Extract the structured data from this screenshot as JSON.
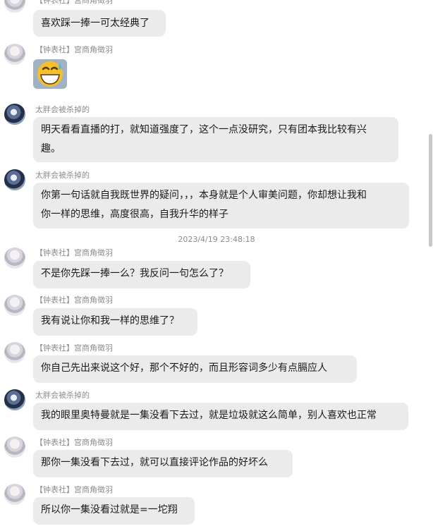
{
  "names": {
    "zhongbiao": "【钟表社】宫商角徵羽",
    "taipang": "太胖会被杀掉的"
  },
  "messages": [
    {
      "text": "喜欢踩一捧一可太经典了"
    },
    {
      "emoji": "grinning-sweat-emoji"
    },
    {
      "lines": [
        "明天看看直播的打，就知道强度了，这个一点没研究，只有团本我比较有兴",
        "趣。"
      ]
    },
    {
      "lines": [
        "你第一句话就自我既世界的疑问，，，本身就是个人审美问题，你却想让我和",
        "你一样的思维，高度很高，自我升华的样子"
      ]
    },
    {
      "text": "不是你先踩一捧一么？我反问一句怎么了？"
    },
    {
      "text": "我有说让你和我一样的思维了？"
    },
    {
      "text": "你自己先出来说这个好，那个不好的，而且形容词多少有点膈应人"
    },
    {
      "text": "我的眼里奥特曼就是一集没看下去过，就是垃圾就这么简单，别人喜欢也正常"
    },
    {
      "text": "那你一集没看下去过，就可以直接评论作品的好坏么"
    },
    {
      "text": "所以你一集没看过就是=一坨翔"
    }
  ],
  "timestamp": "2023/4/19 23:48:18",
  "colors": {
    "bubble": "#ebebeb",
    "meta_text": "#8c8c8c"
  }
}
